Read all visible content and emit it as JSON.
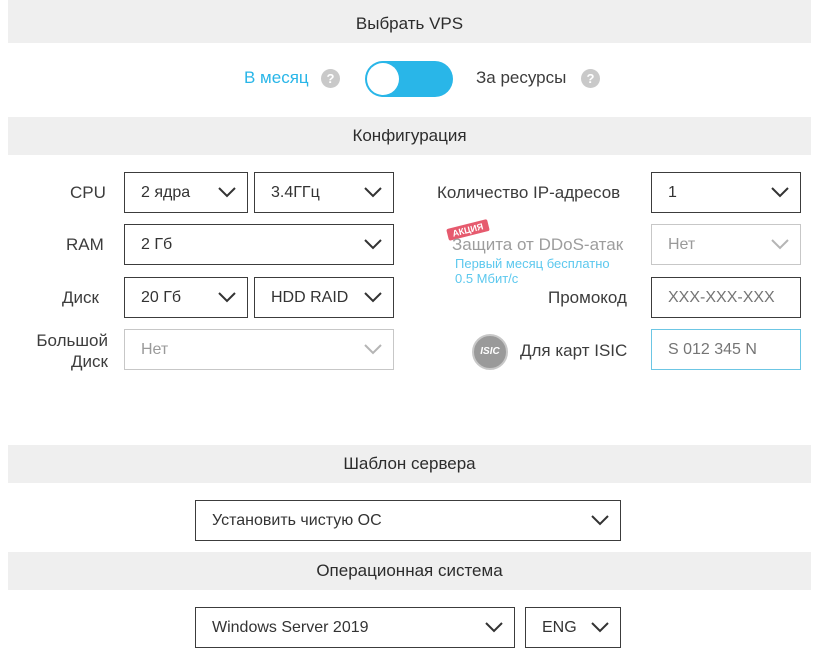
{
  "header": {
    "title": "Выбрать VPS"
  },
  "billing": {
    "left_label": "В месяц",
    "right_label": "За ресурсы",
    "help": "?"
  },
  "config": {
    "title": "Конфигурация",
    "cpu": {
      "label": "CPU",
      "cores": "2 ядра",
      "freq": "3.4ГГц"
    },
    "ram": {
      "label": "RAM",
      "value": "2 Гб"
    },
    "disk": {
      "label": "Диск",
      "size": "20 Гб",
      "type": "HDD RAID"
    },
    "big_disk": {
      "label_line1": "Большой",
      "label_line2": "Диск",
      "value": "Нет"
    },
    "ip": {
      "label": "Количество IP-адресов",
      "value": "1"
    },
    "ddos": {
      "badge": "АКЦИЯ",
      "label": "Защита от DDoS-атак",
      "note_line1": "Первый месяц бесплатно",
      "note_line2": "0.5 Мбит/с",
      "value": "Нет"
    },
    "promo": {
      "label": "Промокод",
      "placeholder": "XXX-XXX-XXX"
    },
    "isic": {
      "logo_text": "ISIC",
      "label": "Для карт ISIC",
      "placeholder": "S 012 345 N"
    }
  },
  "template": {
    "title": "Шаблон сервера",
    "value": "Установить чистую ОС"
  },
  "os": {
    "title": "Операционная система",
    "value": "Windows Server 2019",
    "lang": "ENG"
  },
  "colors": {
    "accent": "#29b6e8",
    "note": "#5cc8ee",
    "badge": "#e65a6e"
  }
}
